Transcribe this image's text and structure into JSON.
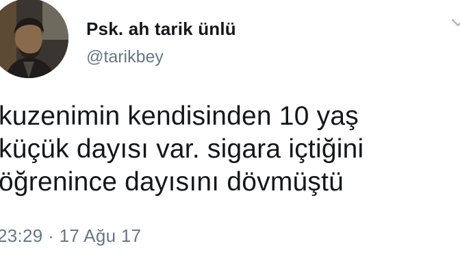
{
  "author": {
    "display_name": "Psk. ah tarik ünlü",
    "handle": "@tarikbey"
  },
  "tweet": {
    "lines": [
      "kuzenimin kendisinden 10 yaş",
      "küçük dayısı var. sigara içtiğini",
      "öğrenince dayısını dövmüştü"
    ],
    "timestamp": "23:29 · 17 Ağu 17"
  },
  "icons": {
    "avatar": "profile-photo",
    "menu": "chevron-down-icon"
  },
  "colors": {
    "text": "#14171a",
    "secondary": "#657786"
  }
}
